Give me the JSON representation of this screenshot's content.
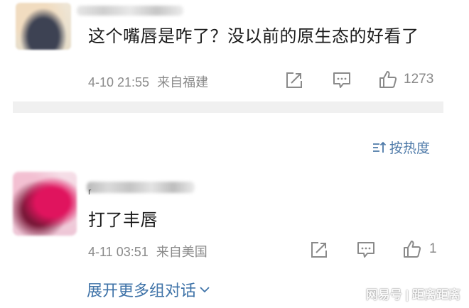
{
  "comments": [
    {
      "text": "这个嘴唇是咋了？没以前的原生态的好看了",
      "timestamp": "4-10 21:55",
      "location": "来自福建",
      "like_count": "1273",
      "icons": [
        "share-icon",
        "comment-icon",
        "like-icon"
      ]
    },
    {
      "name_visible_char": "r",
      "text": "打了丰唇",
      "timestamp": "4-11 03:51",
      "location": "来自美国",
      "like_count": "1",
      "icons": [
        "share-icon",
        "comment-icon",
        "like-icon"
      ]
    }
  ],
  "sort": {
    "label": "按热度",
    "icon": "sort-icon"
  },
  "expand": {
    "label": "展开更多组对话",
    "icon": "chevron-down-icon"
  },
  "watermark": {
    "text": "网易号 | 距离距离"
  },
  "colors": {
    "link": "#3f73a8",
    "meta": "#8a8a8a",
    "divider": "#f0f0f0"
  }
}
